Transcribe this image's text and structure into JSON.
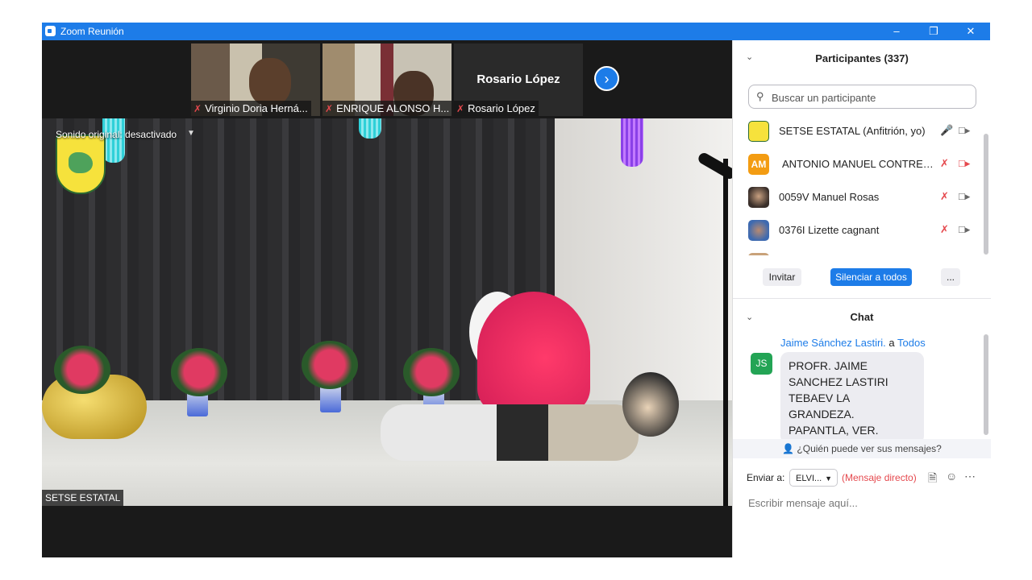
{
  "window": {
    "title": "Zoom Reunión",
    "min_icon": "minimize-icon",
    "restore_icon": "restore-icon",
    "close_icon": "close-icon"
  },
  "thumbnails": [
    {
      "name": "Virginio Doria Herná...",
      "muted": true
    },
    {
      "name": "ENRIQUE ALONSO H...",
      "muted": true
    },
    {
      "name": "Rosario López",
      "muted": true,
      "big_name": "Rosario López"
    }
  ],
  "main_video": {
    "audio_label": "Sonido original: desactivado",
    "speaker_name": "SETSE ESTATAL"
  },
  "participants": {
    "title": "Participantes (337)",
    "search_placeholder": "Buscar un participante",
    "list": [
      {
        "name": "SETSE ESTATAL (Anfitrión, yo)",
        "avatar": "logo",
        "mic": "on",
        "video": "off"
      },
      {
        "name": "ANTONIO MANUEL CONTRER...",
        "avatar": "AM",
        "mic": "muted",
        "video": "muted"
      },
      {
        "name": "0059V Manuel Rosas",
        "avatar": "photo",
        "mic": "muted",
        "video": "off"
      },
      {
        "name": "0376I Lizette cagnant",
        "avatar": "photo",
        "mic": "muted",
        "video": "off"
      }
    ],
    "invite_label": "Invitar",
    "mute_all_label": "Silenciar a todos",
    "more_label": "..."
  },
  "chat": {
    "title": "Chat",
    "message": {
      "sender": "Jaime Sánchez Lastiri.",
      "to_prefix": " a ",
      "to": "Todos",
      "avatar": "JS",
      "text": "PROFR. JAIME SANCHEZ LASTIRI TEBAEV LA GRANDEZA. PAPANTLA, VER."
    },
    "who_can_see": "¿Quién puede ver sus mensajes?",
    "send_to_label": "Enviar a:",
    "send_to_value": "ELVI...",
    "direct_label": "(Mensaje directo)",
    "input_placeholder": "Escribir mensaje aquí..."
  },
  "colors": {
    "accent": "#1d7ce8",
    "muted_red": "#e5484d",
    "avatar_orange": "#f39c12",
    "avatar_green": "#23a455"
  }
}
